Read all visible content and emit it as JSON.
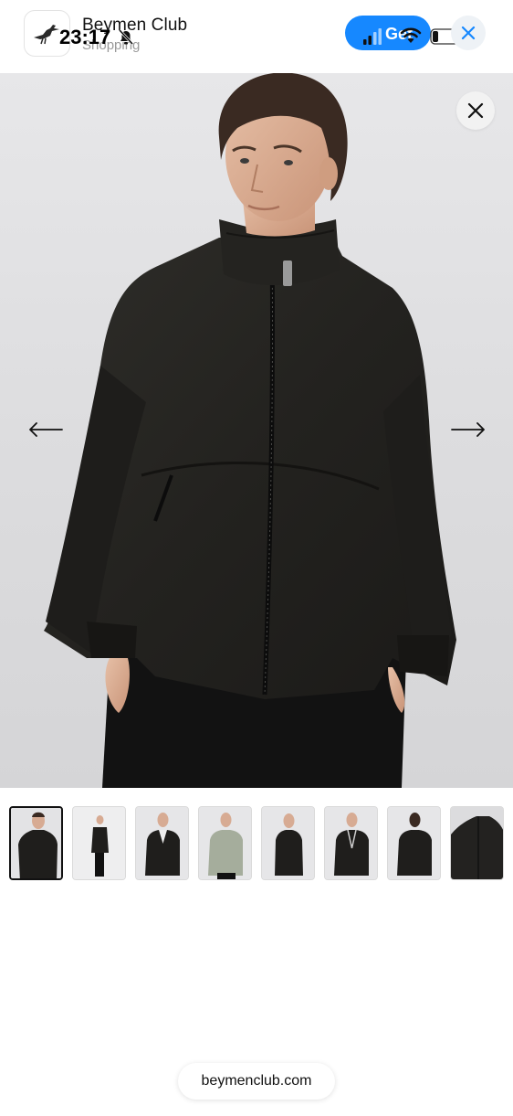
{
  "status_bar": {
    "time": "23:17"
  },
  "app_banner": {
    "name": "Beymen Club",
    "category": "Shopping",
    "get_label": "Get",
    "accent_color": "#1688ff"
  },
  "gallery": {
    "thumbnail_count": 8,
    "active_thumbnail": 1,
    "icons": [
      "close-icon",
      "arrow-left-icon",
      "arrow-right-icon"
    ]
  },
  "browser": {
    "url": "beymenclub.com"
  }
}
